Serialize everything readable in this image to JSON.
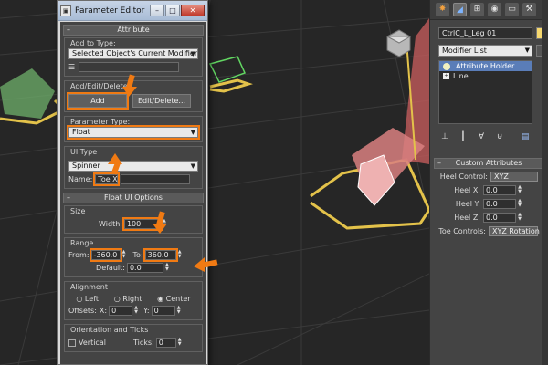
{
  "viewport": {
    "label": ""
  },
  "editor": {
    "title": "Parameter Editor",
    "attribute_rollout": "Attribute",
    "add_to_type_label": "Add to Type:",
    "add_to_type_value": "Selected Object's Current Modifier",
    "add_edit_delete_label": "Add/Edit/Delete",
    "add_button": "Add",
    "edit_delete_button": "Edit/Delete...",
    "param_type_label": "Parameter Type:",
    "param_type_value": "Float",
    "ui_type_label": "UI Type",
    "ui_type_value": "Spinner",
    "name_label": "Name:",
    "name_value": "Toe X",
    "float_rollout": "Float UI Options",
    "size_label": "Size",
    "width_label": "Width:",
    "width_value": "100",
    "range_label": "Range",
    "from_label": "From:",
    "from_value": "-360.0",
    "to_label": "To:",
    "to_value": "360.0",
    "default_label": "Default:",
    "default_value": "0.0",
    "alignment_label": "Alignment",
    "align_left": "Left",
    "align_right": "Right",
    "align_center": "Center",
    "offsets_label": "Offsets:",
    "offset_x_label": "X:",
    "offset_x_value": "0",
    "offset_y_label": "Y:",
    "offset_y_value": "0",
    "orient_label": "Orientation and Ticks",
    "vertical_label": "Vertical",
    "ticks_label": "Ticks:",
    "ticks_value": "0"
  },
  "command_panel": {
    "object_name": "CtrlC_L_Leg 01",
    "modifier_list": "Modifier List",
    "stack": [
      "Attribute Holder",
      "Line"
    ],
    "custom_attr_title": "Custom Attributes",
    "heel_control_label": "Heel Control:",
    "heel_control_value": "XYZ",
    "heel_x_label": "Heel X:",
    "heel_x_value": "0.0",
    "heel_y_label": "Heel Y:",
    "heel_y_value": "0.0",
    "heel_z_label": "Heel Z:",
    "heel_z_value": "0.0",
    "toe_controls_label": "Toe Controls:",
    "toe_controls_value": "XYZ Rotation"
  }
}
